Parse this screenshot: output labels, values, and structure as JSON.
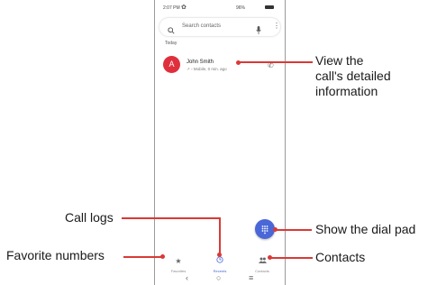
{
  "status_bar": {
    "time": "2:07 PM",
    "signal_battery": "96%"
  },
  "search": {
    "placeholder": "Search contacts"
  },
  "recents": {
    "section_label": "Today",
    "items": [
      {
        "avatar_letter": "A",
        "name": "John Smith",
        "detail": "Mobile, 0 min. ago"
      }
    ]
  },
  "bottom_nav": {
    "items": [
      {
        "label": "Favorites"
      },
      {
        "label": "Recents"
      },
      {
        "label": "Contacts"
      }
    ]
  },
  "callouts": {
    "view_details": [
      "View the",
      "call's detailed",
      "information"
    ],
    "call_logs": "Call logs",
    "favorites": "Favorite numbers",
    "dial_pad": "Show the dial pad",
    "contacts": "Contacts"
  },
  "colors": {
    "avatar": "#e02f3c",
    "fab": "#4a67d8",
    "active_nav": "#4a67d8",
    "callout_line": "#d93a36"
  },
  "icons": [
    "gear-icon",
    "search-icon",
    "mic-icon",
    "more-vert-icon",
    "phone-icon",
    "dialpad-icon",
    "star-icon",
    "clock-icon",
    "contacts-icon",
    "back-icon",
    "home-icon",
    "recents-icon"
  ]
}
